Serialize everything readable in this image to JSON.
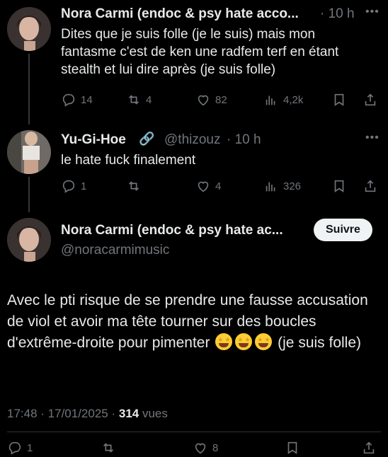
{
  "tweet1": {
    "display_name": "Nora Carmi (endoc & psy hate acco...",
    "time": "· 10 h",
    "text": "Dites que je suis folle (je le suis) mais mon fantasme c'est de ken une radfem terf en étant stealth et lui dire après (je suis folle)",
    "replies": "14",
    "reposts": "4",
    "likes": "82",
    "views": "4,2k"
  },
  "tweet2": {
    "display_name": "Yu-Gi-Hoe",
    "link_emoji": "🔗",
    "handle": "@thizouz",
    "time": "· 10 h",
    "text": "le hate fuck finalement",
    "replies": "1",
    "reposts": "",
    "likes": "4",
    "views": "326"
  },
  "main_tweet": {
    "display_name": "Nora Carmi (endoc & psy hate ac...",
    "handle": "@noracarmimusic",
    "follow_label": "Suivre",
    "text_before_emoji": "Avec le pti risque de se prendre une fausse accusation de viol et avoir ma tête tourner sur des boucles d'extrême-droite pour pimenter ",
    "text_after_emoji": " (je suis folle)",
    "emoji_name": "star-struck",
    "time": "17:48",
    "date": "17/01/2025",
    "views_count": "314",
    "views_label": "vues",
    "replies": "1",
    "likes": "8"
  },
  "icons": [
    "more-icon",
    "reply-icon",
    "repost-icon",
    "like-icon",
    "views-icon",
    "bookmark-icon",
    "share-icon",
    "link-icon"
  ],
  "colors": {
    "background": "#000000",
    "text": "#e7e9ea",
    "muted": "#71767b",
    "button_bg": "#eff3f4"
  }
}
